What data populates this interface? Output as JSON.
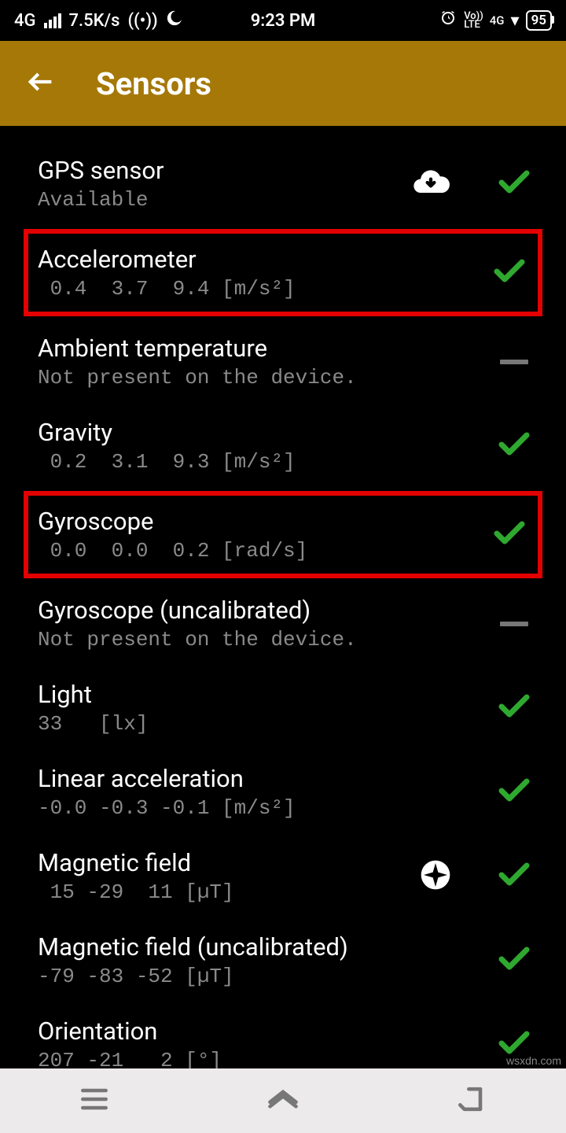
{
  "status": {
    "network": "4G",
    "speed": "7.5K/s",
    "time": "9:23 PM",
    "volte": "Vo))",
    "lte": "LTE",
    "net2": "4G",
    "battery": "95"
  },
  "header": {
    "title": "Sensors"
  },
  "sensors": [
    {
      "name": "GPS sensor",
      "value": "Available",
      "status": "check",
      "icon": "cloud",
      "highlight": false
    },
    {
      "name": "Accelerometer",
      "value": " 0.4  3.7  9.4 [m/s²]",
      "status": "check",
      "icon": null,
      "highlight": true
    },
    {
      "name": "Ambient temperature",
      "value": "Not present on the device.",
      "status": "dash",
      "icon": null,
      "highlight": false
    },
    {
      "name": "Gravity",
      "value": " 0.2  3.1  9.3 [m/s²]",
      "status": "check",
      "icon": null,
      "highlight": false
    },
    {
      "name": "Gyroscope",
      "value": " 0.0  0.0  0.2 [rad/s]",
      "status": "check",
      "icon": null,
      "highlight": true
    },
    {
      "name": "Gyroscope (uncalibrated)",
      "value": "Not present on the device.",
      "status": "dash",
      "icon": null,
      "highlight": false
    },
    {
      "name": "Light",
      "value": "33   [lx]",
      "status": "check",
      "icon": null,
      "highlight": false
    },
    {
      "name": "Linear acceleration",
      "value": "-0.0 -0.3 -0.1 [m/s²]",
      "status": "check",
      "icon": null,
      "highlight": false
    },
    {
      "name": "Magnetic field",
      "value": " 15 -29  11 [µT]",
      "status": "check",
      "icon": "compass",
      "highlight": false
    },
    {
      "name": "Magnetic field (uncalibrated)",
      "value": "-79 -83 -52 [µT]",
      "status": "check",
      "icon": null,
      "highlight": false
    },
    {
      "name": "Orientation",
      "value": "207 -21   2 [°]",
      "status": "check",
      "icon": null,
      "highlight": false
    }
  ],
  "watermark": "wsxdn.com"
}
